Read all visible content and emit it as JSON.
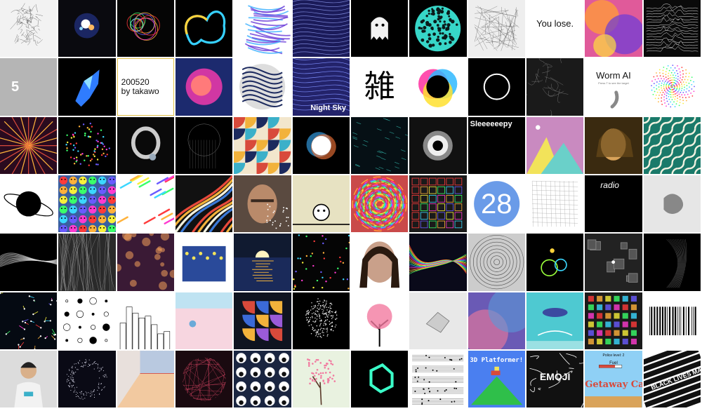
{
  "gallery": {
    "tiles": [
      {
        "label": "portrait sketch",
        "bg": "#f2f2f2",
        "art": "scribble"
      },
      {
        "label": "glowing particles",
        "bg": "#0a0a0f",
        "art": "glow"
      },
      {
        "label": "rainbow bubbles",
        "bg": "#050505",
        "art": "bubbles"
      },
      {
        "label": "neon blob outline",
        "bg": "#000000",
        "art": "neonblob"
      },
      {
        "label": "purple brush strokes",
        "bg": "#ffffff",
        "art": "brush"
      },
      {
        "label": "flow lines",
        "bg": "#1b1b5a",
        "art": "flow"
      },
      {
        "label": "ghost",
        "bg": "#000000",
        "art": "ghost"
      },
      {
        "label": "cyan dot sphere",
        "bg": "#000000",
        "art": "dotsphere"
      },
      {
        "label": "crumpled mesh",
        "bg": "#eeeeee",
        "art": "mesh"
      },
      {
        "label": "you lose game",
        "bg": "#ffffff",
        "art": "text",
        "text": "You lose.",
        "color": "#111111",
        "size": 13,
        "align": "center"
      },
      {
        "label": "fluid colors",
        "bg": "#e05a9a",
        "art": "fluid"
      },
      {
        "label": "joy division lines",
        "bg": "#0a0a0a",
        "art": "joy"
      },
      {
        "label": "number five",
        "bg": "#b5b5b5",
        "art": "text",
        "text": "5",
        "color": "#ffffff",
        "size": 20,
        "align": "left"
      },
      {
        "label": "blue crystal shape",
        "bg": "#000000",
        "art": "crystal"
      },
      {
        "label": "date signature",
        "bg": "#ffffff",
        "art": "text",
        "text": "200520\nby takawo",
        "color": "#111111",
        "size": 12,
        "align": "left",
        "border": "#e3c24a"
      },
      {
        "label": "pink gradient blob",
        "bg": "#1c2a6e",
        "art": "pinkblob"
      },
      {
        "label": "marbled sphere",
        "bg": "#ffffff",
        "art": "marble"
      },
      {
        "label": "night sky",
        "bg": "#23236b",
        "art": "nightsky",
        "text": "Night Sky"
      },
      {
        "label": "kanji glyphs",
        "bg": "#ffffff",
        "art": "text",
        "text": "雑",
        "color": "#000000",
        "size": 44,
        "align": "center"
      },
      {
        "label": "cmyk blobs",
        "bg": "#ffffff",
        "art": "cmyk"
      },
      {
        "label": "white ring",
        "bg": "#000000",
        "art": "ring"
      },
      {
        "label": "smoke swirl",
        "bg": "#1a1a1a",
        "art": "smoke"
      },
      {
        "label": "worm ai",
        "bg": "#ffffff",
        "art": "worm",
        "text": "Worm AI",
        "sub": "Press T to see the target"
      },
      {
        "label": "color spiral",
        "bg": "#ffffff",
        "art": "spiral"
      },
      {
        "label": "kaleidoscope",
        "bg": "#2a0b1f",
        "art": "kaleido"
      },
      {
        "label": "rainbow dots",
        "bg": "#000000",
        "art": "rainbowdots"
      },
      {
        "label": "torus render",
        "bg": "#0a0a0a",
        "art": "torus"
      },
      {
        "label": "wire jellyfish",
        "bg": "#000000",
        "art": "jelly"
      },
      {
        "label": "geometric pattern",
        "bg": "#f2e6cc",
        "art": "geo"
      },
      {
        "label": "chromatic glow",
        "bg": "#000000",
        "art": "chroma"
      },
      {
        "label": "teal streaks",
        "bg": "#061015",
        "art": "streaks"
      },
      {
        "label": "black hole",
        "bg": "#111111",
        "art": "blackhole"
      },
      {
        "label": "sleepy text",
        "bg": "#000000",
        "art": "sleepy",
        "text": "Sleeeeeepy"
      },
      {
        "label": "pastel mountains",
        "bg": "#c98ac0",
        "art": "mountains"
      },
      {
        "label": "painted portrait",
        "bg": "#3a2a10",
        "art": "portrait"
      },
      {
        "label": "truchet tiles",
        "bg": "#1a7a6a",
        "art": "truchet"
      },
      {
        "label": "planet outline",
        "bg": "#ffffff",
        "art": "planet"
      },
      {
        "label": "emoji faces",
        "bg": "#3a5fa0",
        "art": "emoji"
      },
      {
        "label": "confetti streaks",
        "bg": "#ffffff",
        "art": "confetti"
      },
      {
        "label": "retro stripes",
        "bg": "#111111",
        "art": "stripes"
      },
      {
        "label": "glitch face",
        "bg": "#5a4a40",
        "art": "face"
      },
      {
        "label": "mouse creature",
        "bg": "#e7e2c2",
        "art": "creature"
      },
      {
        "label": "swirl collage",
        "bg": "#c94a4a",
        "art": "swirl"
      },
      {
        "label": "symbol grid",
        "bg": "#1a1a1a",
        "art": "symgrid"
      },
      {
        "label": "number 28",
        "bg": "#ffffff",
        "art": "twentyeight",
        "text": "28"
      },
      {
        "label": "melting grid",
        "bg": "#ffffff",
        "art": "melt"
      },
      {
        "label": "radio words",
        "bg": "#000000",
        "art": "radio",
        "text": "radio"
      },
      {
        "label": "ghost sculpture",
        "bg": "#e6e6e6",
        "art": "sculpt"
      },
      {
        "label": "white smoke",
        "bg": "#000000",
        "art": "smokewhite"
      },
      {
        "label": "fur strands",
        "bg": "#2a2a2a",
        "art": "fur"
      },
      {
        "label": "bokeh lights",
        "bg": "#3a1a35",
        "art": "bokeh"
      },
      {
        "label": "starry night",
        "bg": "#ffffff",
        "art": "starry"
      },
      {
        "label": "sunset sea",
        "bg": "#101a30",
        "art": "sunset"
      },
      {
        "label": "neon particles",
        "bg": "#050505",
        "art": "particles"
      },
      {
        "label": "mosaic portrait",
        "bg": "#ffffff",
        "art": "mosaicface"
      },
      {
        "label": "color waves",
        "bg": "#0a0a1a",
        "art": "waves"
      },
      {
        "label": "gray tunnel",
        "bg": "#cccccc",
        "art": "tunnel"
      },
      {
        "label": "neon rings",
        "bg": "#000000",
        "art": "neonrings"
      },
      {
        "label": "3d cubes room",
        "bg": "#222222",
        "art": "cubes"
      },
      {
        "label": "dark folds",
        "bg": "#000000",
        "art": "folds"
      },
      {
        "label": "voronoi neon",
        "bg": "#050a12",
        "art": "voronoi"
      },
      {
        "label": "icon sheet",
        "bg": "#ffffff",
        "art": "iconsheet"
      },
      {
        "label": "city sketch",
        "bg": "#ffffff",
        "art": "city"
      },
      {
        "label": "pastel sunset",
        "bg": "#f7d6e0",
        "art": "pastelsun"
      },
      {
        "label": "bauhaus shapes",
        "bg": "#0f1420",
        "art": "bauhaus"
      },
      {
        "label": "dot face",
        "bg": "#000000",
        "art": "dotface"
      },
      {
        "label": "pink tree",
        "bg": "#ffffff",
        "art": "pinktree"
      },
      {
        "label": "paper bird",
        "bg": "#e8e8e8",
        "art": "paperbird"
      },
      {
        "label": "gradient mist",
        "bg": "#6a5ab5",
        "art": "mist"
      },
      {
        "label": "whale scene",
        "bg": "#4ec9d1",
        "art": "whale"
      },
      {
        "label": "pixel sprites",
        "bg": "#1a1a1a",
        "art": "sprites"
      },
      {
        "label": "barcode",
        "bg": "#ffffff",
        "art": "barcode"
      },
      {
        "label": "webcam person",
        "bg": "#dcdcdc",
        "art": "person"
      },
      {
        "label": "star ring",
        "bg": "#0a0a15",
        "art": "starring"
      },
      {
        "label": "pastel room",
        "bg": "#e8e0dc",
        "art": "room"
      },
      {
        "label": "string sphere",
        "bg": "#1a0a10",
        "art": "string"
      },
      {
        "label": "eye grid",
        "bg": "#1a2540",
        "art": "eyes"
      },
      {
        "label": "cherry blossom",
        "bg": "#e9f2e0",
        "art": "blossom"
      },
      {
        "label": "neon cube",
        "bg": "#000000",
        "art": "neoncube"
      },
      {
        "label": "sheet music",
        "bg": "#ffffff",
        "art": "music"
      },
      {
        "label": "3d platformer",
        "bg": "#4a7ff0",
        "art": "platformer",
        "text": "3D Platformer!"
      },
      {
        "label": "emoji graffiti",
        "bg": "#111111",
        "art": "graffiti",
        "text": "EMOJI"
      },
      {
        "label": "getaway car",
        "bg": "#8fd0f5",
        "art": "getaway",
        "text": "Getaway Car!",
        "sub": "Police level: 2",
        "sub2": "Fuel"
      },
      {
        "label": "black lives matter",
        "bg": "#ffffff",
        "art": "blm",
        "text": "BLACK LIVES MATTER"
      }
    ]
  }
}
